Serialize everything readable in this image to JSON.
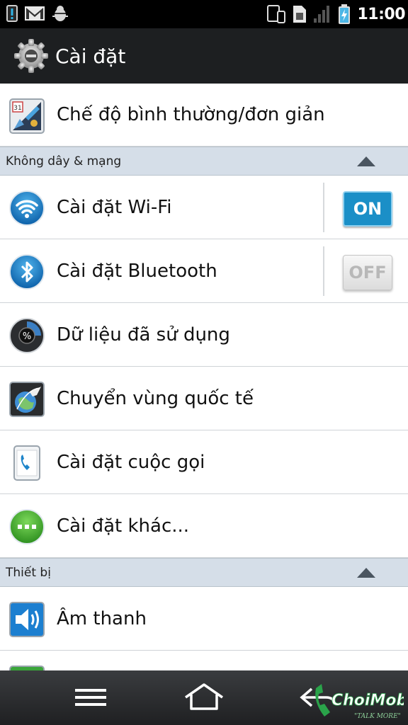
{
  "status_bar": {
    "time": "11:00",
    "left_icons": [
      "alert-icon",
      "gmail-icon",
      "android-debug-icon"
    ],
    "right_icons": [
      "phone-tablet-icon",
      "sim-icon",
      "signal-icon",
      "battery-charging-icon"
    ]
  },
  "title_bar": {
    "title": "Cài đặt",
    "icon": "settings-gear-icon"
  },
  "items_top": [
    {
      "label": "Chế độ bình thường/đơn giản",
      "icon": "calendar-app-icon"
    }
  ],
  "sections": [
    {
      "label": "Không dây & mạng",
      "items": [
        {
          "label": "Cài đặt Wi-Fi",
          "icon": "wifi-icon",
          "toggle": "ON"
        },
        {
          "label": "Cài đặt Bluetooth",
          "icon": "bluetooth-icon",
          "toggle": "OFF"
        },
        {
          "label": "Dữ liệu đã sử dụng",
          "icon": "data-usage-icon"
        },
        {
          "label": "Chuyển vùng quốc tế",
          "icon": "roaming-globe-icon"
        },
        {
          "label": "Cài đặt cuộc gọi",
          "icon": "call-settings-icon"
        },
        {
          "label": "Cài đặt khác...",
          "icon": "more-icon"
        }
      ]
    },
    {
      "label": "Thiết bị",
      "items": [
        {
          "label": "Âm thanh",
          "icon": "speaker-icon"
        }
      ]
    }
  ],
  "nav_bar": {
    "buttons": [
      "menu-icon",
      "home-icon",
      "back-icon"
    ]
  },
  "watermark": {
    "brand": "ChoiMobile",
    "tagline": "TALK MORE"
  },
  "colors": {
    "toggle_on": "#1b8fc7",
    "section_bg": "#d5dee8",
    "title_bg": "#1d1f21"
  }
}
